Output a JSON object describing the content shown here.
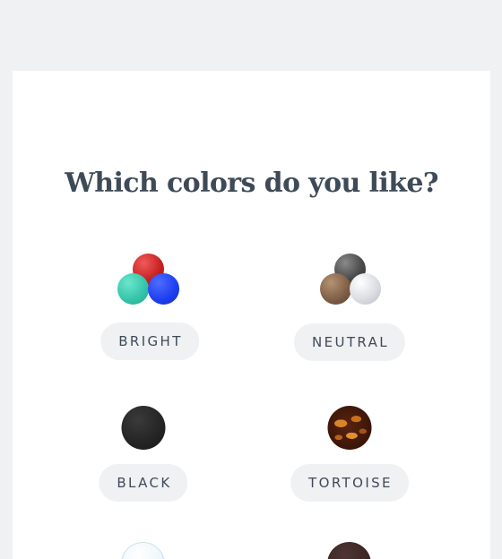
{
  "question": "Which colors do you like?",
  "options": [
    {
      "label": "BRIGHT",
      "icon": "bright-colors-swatch-icon",
      "colors": [
        "#d42a2a",
        "#3ccfb4",
        "#1a3fe6"
      ]
    },
    {
      "label": "NEUTRAL",
      "icon": "neutral-colors-swatch-icon",
      "colors": [
        "#4d4d4d",
        "#8a6a52",
        "#d9dbe1"
      ]
    },
    {
      "label": "BLACK",
      "icon": "black-swatch-icon",
      "colors": [
        "#262626"
      ]
    },
    {
      "label": "TORTOISE",
      "icon": "tortoise-swatch-icon",
      "colors": [
        "#4a1d0e",
        "#c9751e"
      ]
    }
  ],
  "partial_swatches": [
    {
      "icon": "clear-swatch-icon",
      "color": "#eef6fb"
    },
    {
      "icon": "dark-brown-swatch-icon",
      "color": "#3a2624"
    }
  ]
}
